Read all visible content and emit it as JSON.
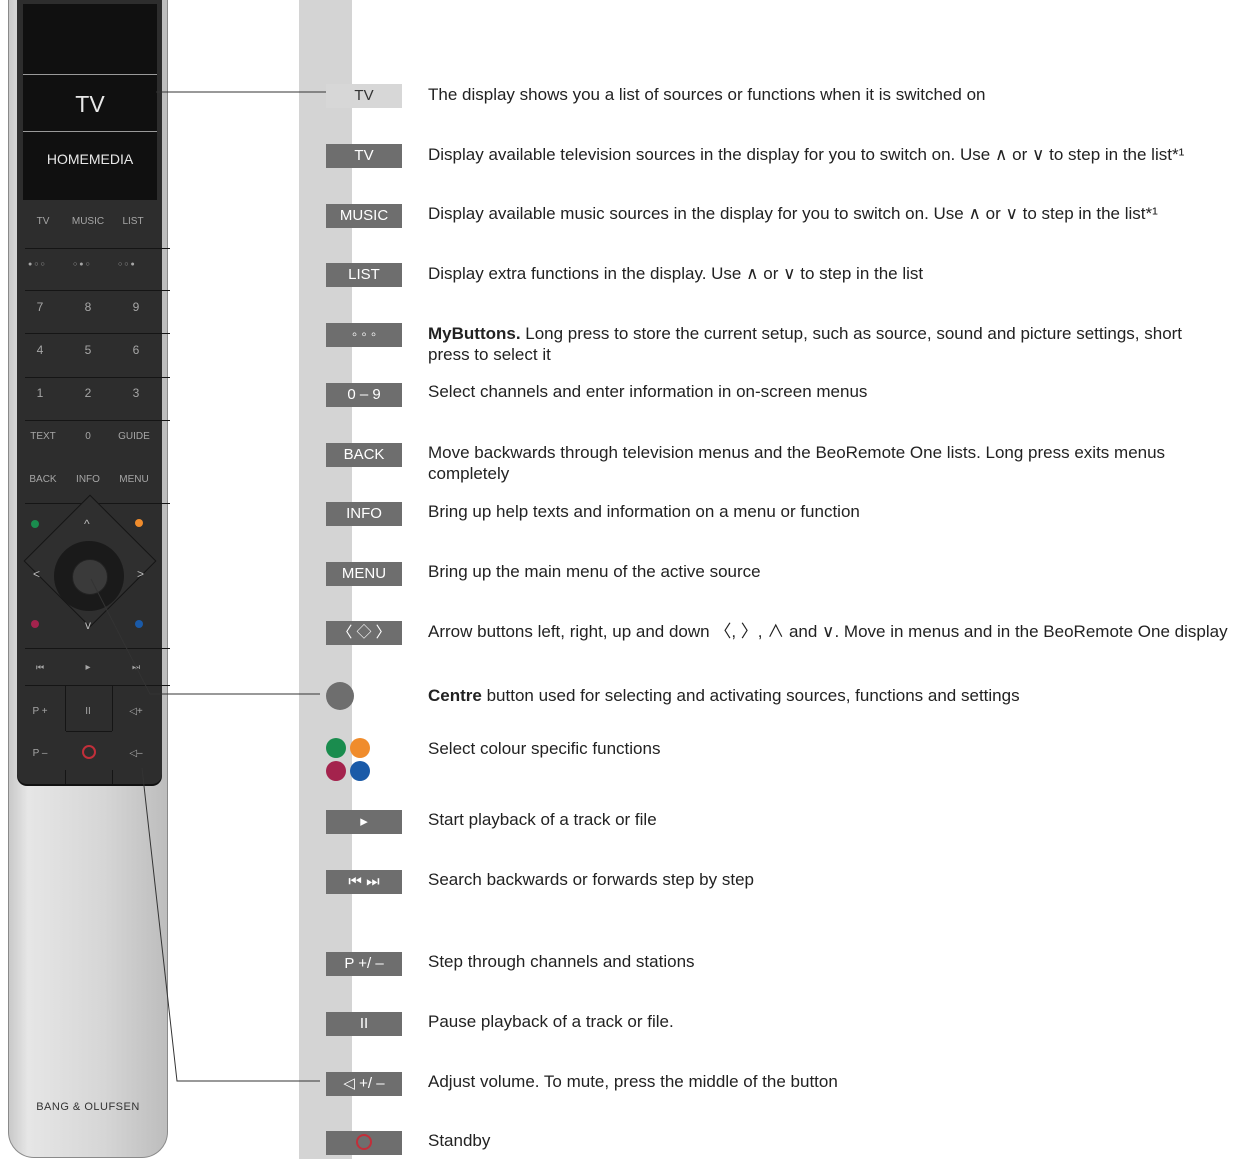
{
  "remote": {
    "screen_main": "TV",
    "screen_sub": "HOMEMEDIA",
    "row_sources": [
      "TV",
      "MUSIC",
      "LIST"
    ],
    "mybuttons": [
      "●○○",
      "○●○",
      "○○●"
    ],
    "digits": [
      "7",
      "8",
      "9",
      "4",
      "5",
      "6",
      "1",
      "2",
      "3"
    ],
    "row_text": [
      "TEXT",
      "0",
      "GUIDE"
    ],
    "row_back": [
      "BACK",
      "INFO",
      "MENU"
    ],
    "arrows": {
      "up": "^",
      "down": "v",
      "left": "<",
      "right": ">"
    },
    "transport": [
      "⏮",
      "▸",
      "⏭"
    ],
    "p_plus": "P +",
    "pause": "II",
    "vol_plus": "◁+",
    "p_minus": "P –",
    "vol_minus": "◁–",
    "brand": "BANG & OLUFSEN",
    "colors": {
      "green": "#1a8c4e",
      "orange": "#f08c2c",
      "red": "#a4234d",
      "blue": "#1a5aa8"
    }
  },
  "legend": [
    {
      "key": "TV",
      "style": "light",
      "text": "The display shows you a list of sources or functions when it is switched on"
    },
    {
      "key": "TV",
      "text": "Display available television sources in the display for you to switch on. Use ∧ or ∨ to step in the list*¹"
    },
    {
      "key": "MUSIC",
      "text": "Display available music sources in the display for you to switch on. Use ∧ or ∨ to step in the list*¹"
    },
    {
      "key": "LIST",
      "text": "Display extra functions in the display. Use ∧ or ∨ to step in the list"
    },
    {
      "key": "◦ ◦ ◦",
      "bold": "MyButtons.",
      "text": " Long press to store the current setup, such as source, sound and picture settings, short press to select it"
    },
    {
      "key": "0 – 9",
      "text": "Select channels and enter information in on-screen menus"
    },
    {
      "key": "BACK",
      "text": "Move backwards through television menus and the BeoRemote One lists. Long press exits menus completely"
    },
    {
      "key": "INFO",
      "text": "Bring up help texts and information on a menu or function"
    },
    {
      "key": "MENU",
      "text": "Bring up the main menu of the active source"
    },
    {
      "key": "〈 ◇ 〉",
      "text": "Arrow buttons left, right, up and down 〈, 〉, ∧ and ∨. Move in menus and in the BeoRemote One display"
    },
    {
      "key": "",
      "bold": "Centre",
      "text": " button used for selecting and activating sources, functions and settings"
    },
    {
      "key": "",
      "text": "Select colour specific functions"
    },
    {
      "key": "▸",
      "text": "Start playback of a track or file"
    },
    {
      "key": "⏮  ⏭",
      "text": "Search backwards or forwards step by step"
    },
    {
      "key": "P +/ –",
      "text": "Step through channels and stations"
    },
    {
      "key": "II",
      "text": "Pause playback of a track or file."
    },
    {
      "key": "◁ +/ –",
      "text": "Adjust volume. To mute, press the middle of the button"
    },
    {
      "key": "",
      "text": "Standby"
    }
  ]
}
